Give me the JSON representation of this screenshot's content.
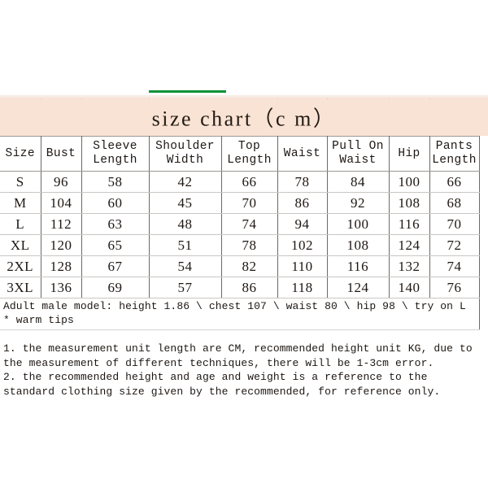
{
  "banner": {
    "title": "size chart（c m）",
    "background_color": "#f9e3d4",
    "accent_color": "#0d9237"
  },
  "table": {
    "columns": [
      "Size",
      "Bust",
      "Sleeve Length",
      "Shoulder Width",
      "Top Length",
      "Waist",
      "Pull On Waist",
      "Hip",
      "Pants Length"
    ],
    "rows": [
      [
        "S",
        "96",
        "58",
        "42",
        "66",
        "78",
        "84",
        "100",
        "66"
      ],
      [
        "M",
        "104",
        "60",
        "45",
        "70",
        "86",
        "92",
        "108",
        "68"
      ],
      [
        "L",
        "112",
        "63",
        "48",
        "74",
        "94",
        "100",
        "116",
        "70"
      ],
      [
        "XL",
        "120",
        "65",
        "51",
        "78",
        "102",
        "108",
        "124",
        "72"
      ],
      [
        "2XL",
        "128",
        "67",
        "54",
        "82",
        "110",
        "116",
        "132",
        "74"
      ],
      [
        "3XL",
        "136",
        "69",
        "57",
        "86",
        "118",
        "124",
        "140",
        "76"
      ]
    ],
    "model_note": "Adult male model: height 1.86 \\ chest 107 \\ waist 80 \\ hip 98 \\ try on L * warm tips"
  },
  "notes": [
    "1. the measurement unit length are CM, recommended height unit KG, due to the measurement of different techniques, there will be 1-3cm error.",
    "2. the recommended height and age and weight is a reference to the standard clothing size given by the recommended, for reference only."
  ]
}
